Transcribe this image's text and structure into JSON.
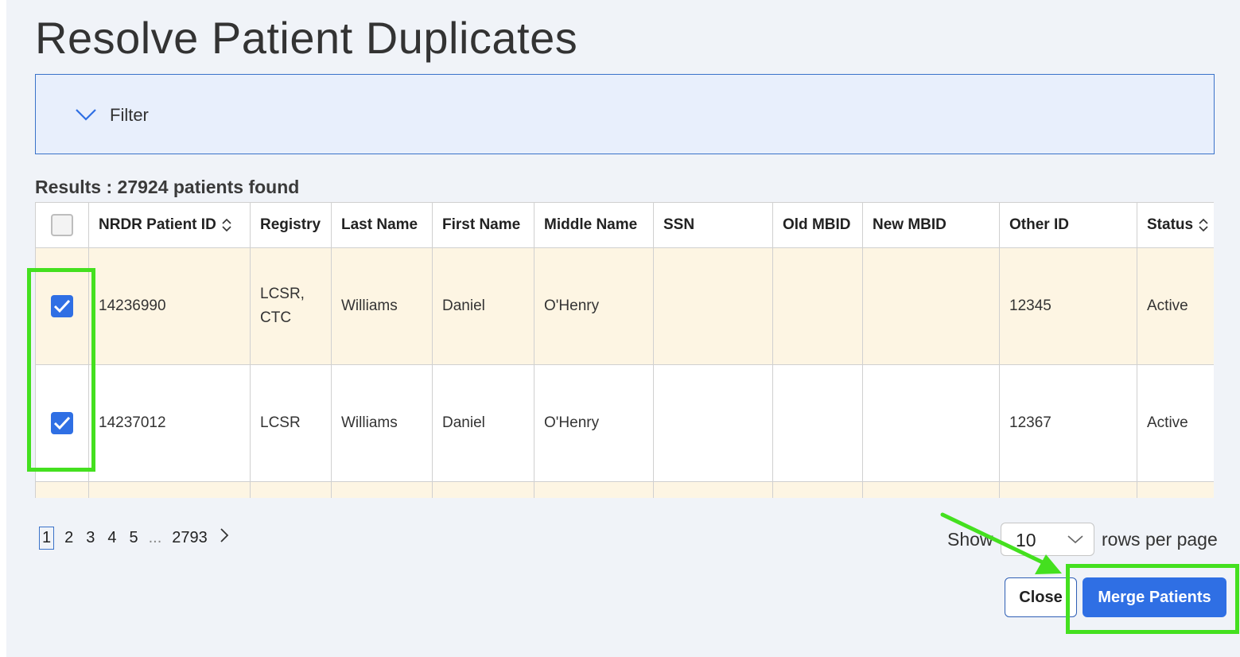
{
  "page": {
    "title": "Resolve Patient Duplicates"
  },
  "filter": {
    "label": "Filter",
    "icon": "chevron-down-icon"
  },
  "results": {
    "text": "Results : 27924 patients found"
  },
  "table": {
    "columns": [
      {
        "key": "select",
        "label": ""
      },
      {
        "key": "nrdr_id",
        "label": "NRDR Patient ID",
        "sortable": true
      },
      {
        "key": "registry",
        "label": "Registry"
      },
      {
        "key": "last_name",
        "label": "Last Name"
      },
      {
        "key": "first_name",
        "label": "First Name"
      },
      {
        "key": "middle_name",
        "label": "Middle Name"
      },
      {
        "key": "ssn",
        "label": "SSN"
      },
      {
        "key": "old_mbid",
        "label": "Old MBID"
      },
      {
        "key": "new_mbid",
        "label": "New MBID"
      },
      {
        "key": "other_id",
        "label": "Other ID"
      },
      {
        "key": "status",
        "label": "Status",
        "sortable": true
      }
    ],
    "rows": [
      {
        "checked": true,
        "nrdr_id": "14236990",
        "registry": [
          "LCSR,",
          "CTC"
        ],
        "last_name": "Williams",
        "first_name": "Daniel",
        "middle_name": "O'Henry",
        "ssn": "",
        "old_mbid": "",
        "new_mbid": "",
        "other_id": "12345",
        "status": "Active"
      },
      {
        "checked": true,
        "nrdr_id": "14237012",
        "registry": [
          "LCSR"
        ],
        "last_name": "Williams",
        "first_name": "Daniel",
        "middle_name": "O'Henry",
        "ssn": "",
        "old_mbid": "",
        "new_mbid": "",
        "other_id": "12367",
        "status": "Active"
      },
      {
        "checked": false,
        "nrdr_id": "",
        "registry": [
          ""
        ],
        "last_name": "",
        "first_name": "",
        "middle_name": "",
        "ssn": "",
        "old_mbid": "",
        "new_mbid": "",
        "other_id": "",
        "status": ""
      }
    ]
  },
  "pagination": {
    "pages": [
      "1",
      "2",
      "3",
      "4",
      "5"
    ],
    "ellipsis": "...",
    "last": "2793",
    "current": "1"
  },
  "rows_per_page": {
    "show_label": "Show",
    "value": "10",
    "suffix": "rows per page"
  },
  "buttons": {
    "close": "Close",
    "merge": "Merge Patients"
  },
  "colors": {
    "accent": "#2f6fe4",
    "highlight": "#44e01f",
    "row_alt": "#fdf5e3",
    "filter_bg": "#e8effc"
  }
}
